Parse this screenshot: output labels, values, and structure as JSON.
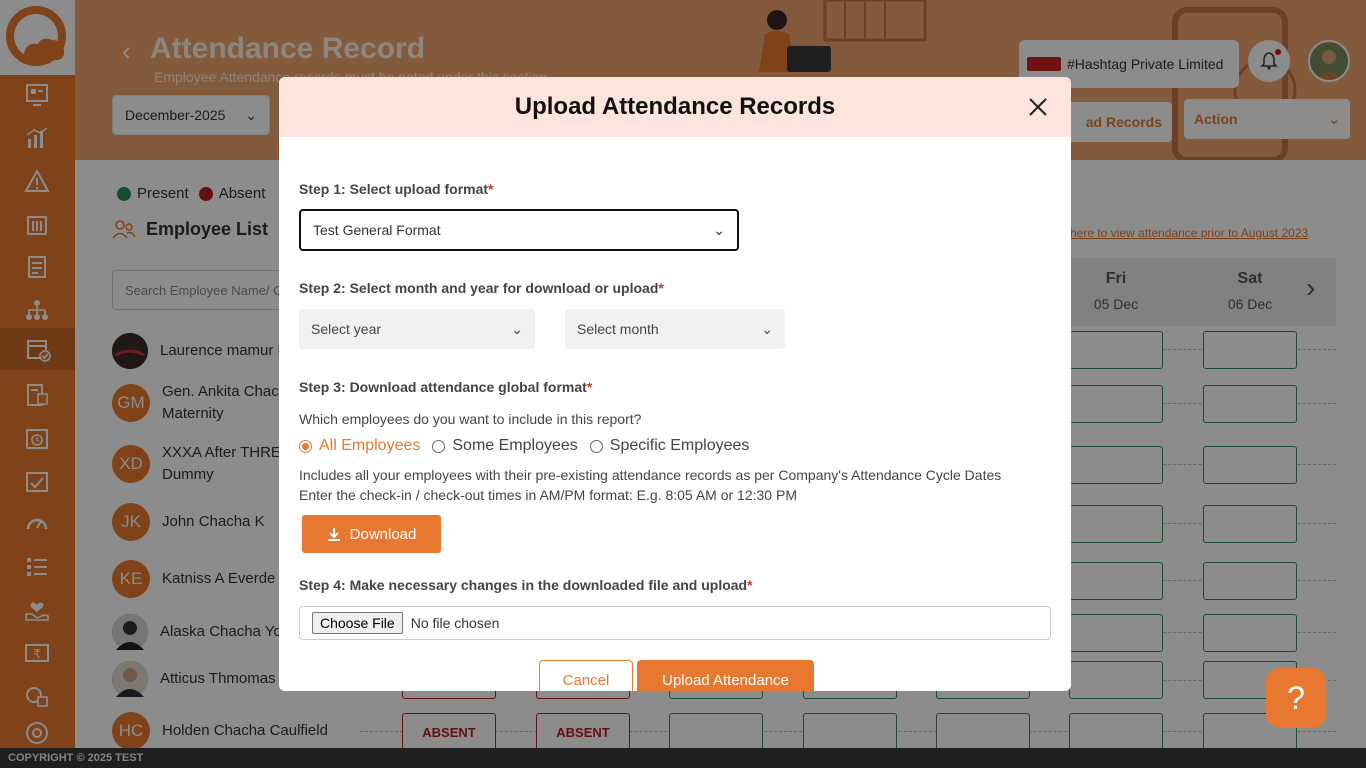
{
  "page": {
    "title": "Attendance Record",
    "subtitle": "Employee Attendance records must be noted under this section",
    "month_value": "December-2025",
    "company_name": "#Hashtag Private Limited",
    "upload_records_label": "ad Records",
    "action_label": "Action",
    "legend_present": "Present",
    "legend_absent": "Absent",
    "employee_list_title": "Employee List",
    "search_placeholder": "Search Employee Name/ C",
    "prior_link": "here to view attendance prior to August 2023",
    "days": [
      {
        "name": "Fri",
        "date": "05 Dec"
      },
      {
        "name": "Sat",
        "date": "06 Dec"
      }
    ],
    "absent_label": "ABSENT",
    "footer": "COPYRIGHT © 2025 TEST",
    "help_glyph": "?"
  },
  "employees": [
    {
      "name": "Laurence mamur B",
      "initials": "",
      "photo": true
    },
    {
      "name": "Gen. Ankita Chac",
      "name2": "Maternity",
      "initials": "GM",
      "photo": false
    },
    {
      "name": "XXXA After THRE",
      "name2": "Dummy",
      "initials": "XD",
      "photo": false
    },
    {
      "name": "John Chacha K",
      "initials": "JK",
      "photo": false
    },
    {
      "name": "Katniss A Everde",
      "initials": "KE",
      "photo": false
    },
    {
      "name": "Alaska Chacha Yo",
      "initials": "",
      "photo": true
    },
    {
      "name": "Atticus Thmomas",
      "initials": "",
      "photo": true
    },
    {
      "name": "Holden Chacha Caulfield",
      "initials": "HC",
      "photo": false
    }
  ],
  "modal": {
    "title": "Upload Attendance Records",
    "step1_label": "Step 1: Select upload format",
    "step1_value": "Test General Format",
    "step2_label": "Step 2: Select month and year for download or upload",
    "year_placeholder": "Select year",
    "month_placeholder": "Select month",
    "step3_label": "Step 3: Download attendance global format",
    "question": "Which employees do you want to include in this report?",
    "radio_all": "All Employees",
    "radio_some": "Some Employees",
    "radio_specific": "Specific Employees",
    "info1": "Includes all your employees with their pre-existing attendance records as per Company's Attendance Cycle Dates",
    "info2": "Enter the check-in / check-out times in AM/PM format: E.g. 8:05 AM or 12:30 PM",
    "download_label": "Download",
    "step4_label": "Step 4: Make necessary changes in the downloaded file and upload",
    "choose_file_label": "Choose File",
    "no_file_label": "No file chosen",
    "cancel_label": "Cancel",
    "upload_label": "Upload Attendance",
    "required_mark": "*"
  },
  "colors": {
    "accent": "#e8782f",
    "present": "#2e8b57",
    "absent": "#b22222",
    "modal_header": "#fde4dd"
  }
}
